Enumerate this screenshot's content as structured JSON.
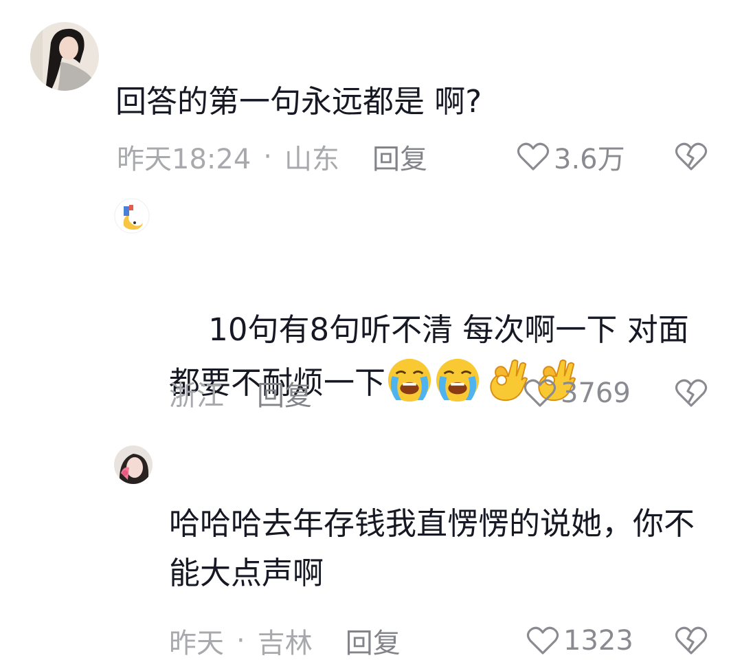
{
  "comments": [
    {
      "text": "回答的第一句永远都是 啊?",
      "time": "昨天18:24",
      "separator": "·",
      "location": "山东",
      "reply_label": "回复",
      "likes": "3.6万"
    },
    {
      "text": "10句有8句听不清 每次啊一下 对面都要不耐烦一下",
      "location": "浙江",
      "reply_label": "回复",
      "likes": "3769",
      "emojis": [
        "loudly-crying-face",
        "loudly-crying-face",
        "ok-hand",
        "ok-hand"
      ]
    },
    {
      "text": "哈哈哈去年存钱我直愣愣的说她，你不能大点声啊",
      "time": "昨天",
      "separator": "·",
      "location": "吉林",
      "reply_label": "回复",
      "likes": "1323"
    }
  ],
  "colors": {
    "text": "#161823",
    "meta": "#a8a9ad",
    "reply": "#838489",
    "like": "#8a8b90"
  }
}
